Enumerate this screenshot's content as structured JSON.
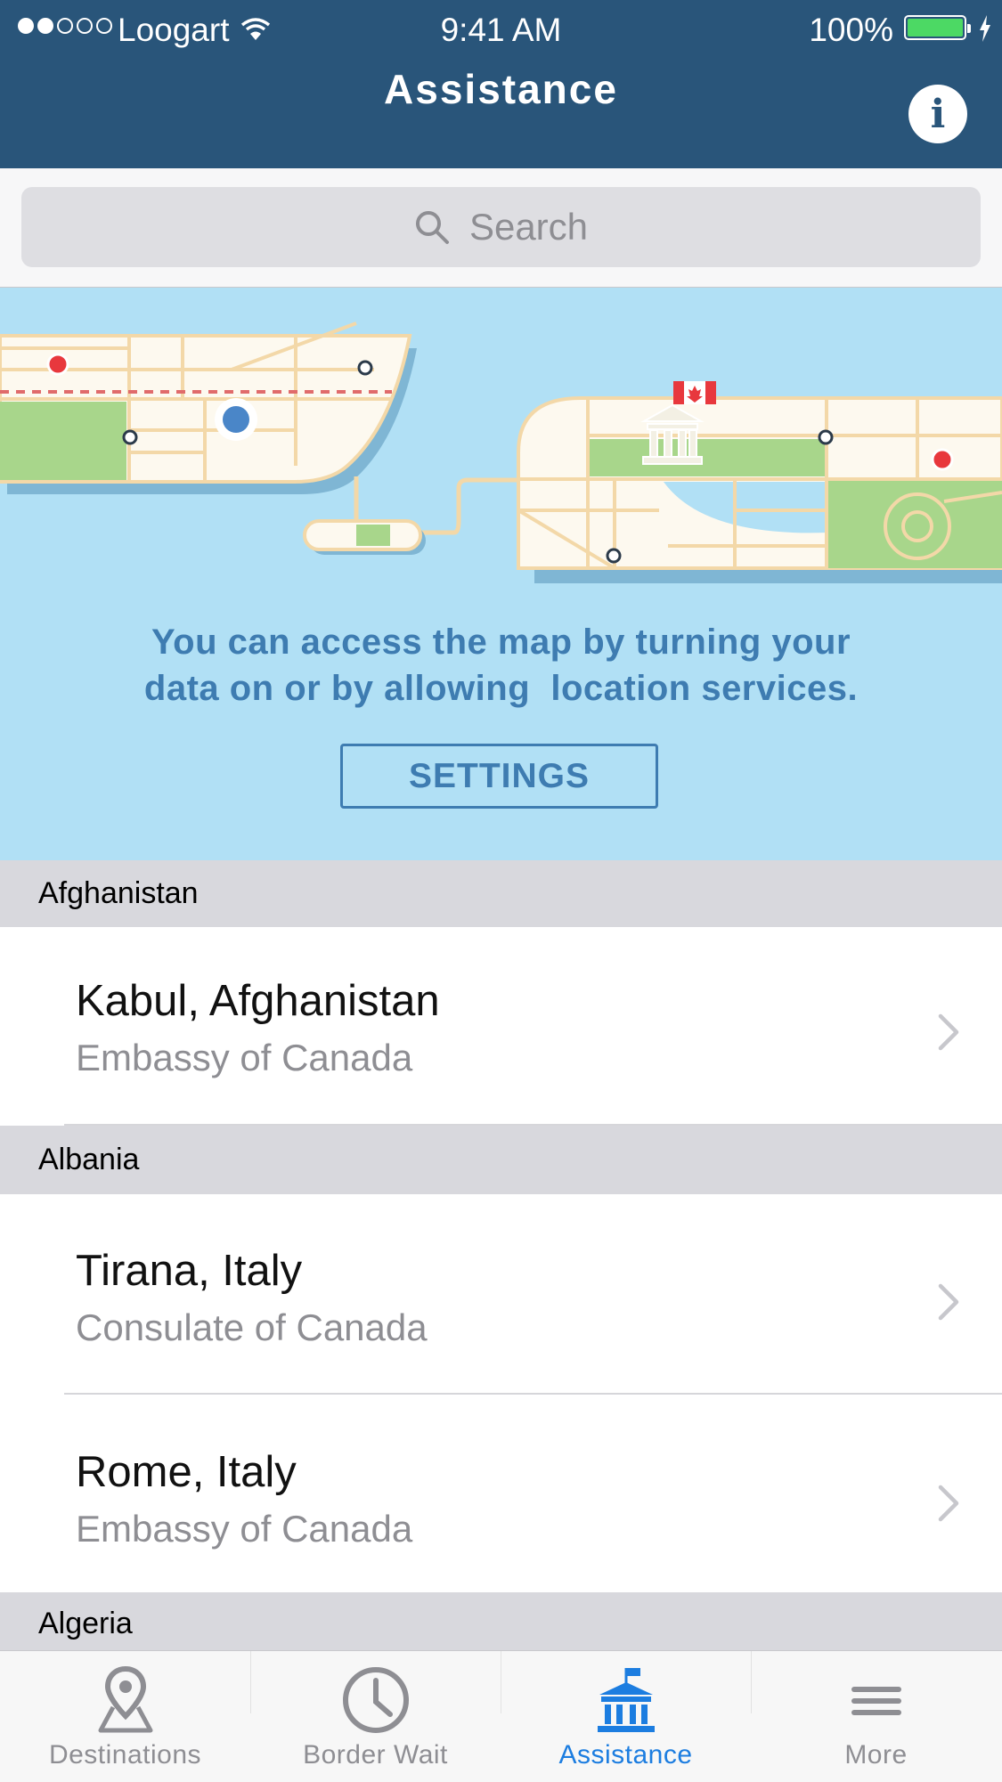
{
  "status_bar": {
    "carrier": "Loogart",
    "time": "9:41 AM",
    "battery": "100%"
  },
  "nav": {
    "title": "Assistance"
  },
  "search": {
    "placeholder": "Search"
  },
  "banner": {
    "message_line1": "You can access the map by turning your",
    "message_line2": "data on or by allowing  location services.",
    "settings_label": "SETTINGS"
  },
  "sections": [
    {
      "header": "Afghanistan",
      "items": [
        {
          "city": "Kabul, Afghanistan",
          "type": "Embassy of Canada"
        }
      ]
    },
    {
      "header": "Albania",
      "items": [
        {
          "city": "Tirana, Italy",
          "type": "Consulate of Canada"
        },
        {
          "city": "Rome, Italy",
          "type": "Embassy of Canada"
        }
      ]
    },
    {
      "header": "Algeria",
      "items": []
    }
  ],
  "tabs": [
    {
      "label": "Destinations",
      "icon": "map-pin-icon",
      "active": false
    },
    {
      "label": "Border Wait",
      "icon": "clock-icon",
      "active": false
    },
    {
      "label": "Assistance",
      "icon": "embassy-icon",
      "active": true
    },
    {
      "label": "More",
      "icon": "menu-icon",
      "active": false
    }
  ],
  "colors": {
    "nav_bg": "#29557a",
    "banner_bg": "#b1e0f5",
    "banner_text": "#3e7cb1",
    "tab_active": "#1c7de0",
    "battery_fill": "#4cd964"
  }
}
